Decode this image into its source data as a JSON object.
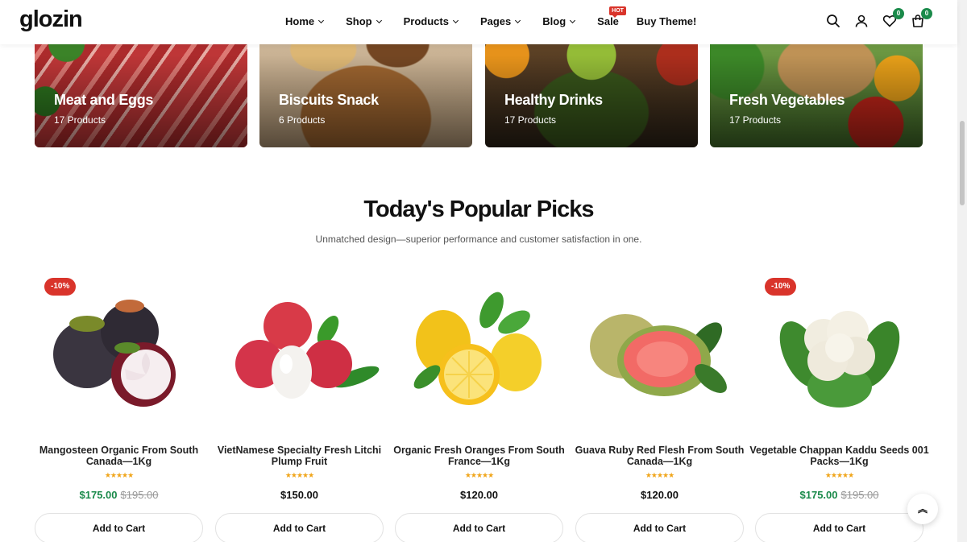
{
  "header": {
    "logo": "glozin",
    "nav": [
      {
        "label": "Home",
        "dropdown": true
      },
      {
        "label": "Shop",
        "dropdown": true
      },
      {
        "label": "Products",
        "dropdown": true
      },
      {
        "label": "Pages",
        "dropdown": true
      },
      {
        "label": "Blog",
        "dropdown": true
      },
      {
        "label": "Sale",
        "dropdown": false,
        "badge": "HOT"
      },
      {
        "label": "Buy Theme!",
        "dropdown": false
      }
    ],
    "wishlist_count": "0",
    "cart_count": "0"
  },
  "categories": [
    {
      "name": "Meat and Eggs",
      "count": "17 Products"
    },
    {
      "name": "Biscuits Snack",
      "count": "6 Products"
    },
    {
      "name": "Healthy Drinks",
      "count": "17 Products"
    },
    {
      "name": "Fresh Vegetables",
      "count": "17 Products"
    }
  ],
  "section": {
    "title": "Today's Popular Picks",
    "subtitle": "Unmatched design—superior performance and customer satisfaction in one."
  },
  "products": [
    {
      "name": "Mangosteen Organic From South Canada—1Kg",
      "rating": 5,
      "stars": "★★★★★",
      "price": "$175.00",
      "old_price": "$195.00",
      "badge": "-10%",
      "button": "Add to Cart"
    },
    {
      "name": "VietNamese Specialty Fresh Litchi Plump Fruit",
      "rating": 4.5,
      "stars": "★★★★★",
      "price": "$150.00",
      "old_price": "",
      "badge": "",
      "button": "Add to Cart"
    },
    {
      "name": "Organic Fresh Oranges From South France—1Kg",
      "rating": 5,
      "stars": "★★★★★",
      "price": "$120.00",
      "old_price": "",
      "badge": "",
      "button": "Add to Cart"
    },
    {
      "name": "Guava Ruby Red Flesh From South Canada—1Kg",
      "rating": 5,
      "stars": "★★★★★",
      "price": "$120.00",
      "old_price": "",
      "badge": "",
      "button": "Add to Cart"
    },
    {
      "name": "Vegetable Chappan Kaddu Seeds 001 Packs—1Kg",
      "rating": 5,
      "stars": "★★★★★",
      "price": "$175.00",
      "old_price": "$195.00",
      "badge": "-10%",
      "button": "Add to Cart"
    }
  ],
  "colors": {
    "accent_green": "#1a8a4a",
    "sale_red": "#d9342b",
    "star": "#f0a51a"
  }
}
